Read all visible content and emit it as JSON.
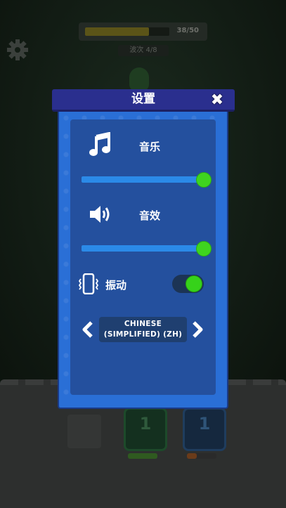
{
  "hud": {
    "progress_text": "38/50",
    "progress_value": 0.76,
    "wave_text": "波次 4/8"
  },
  "settings": {
    "title": "设置",
    "music": {
      "label": "音乐",
      "volume": 1.0
    },
    "sound": {
      "label": "音效",
      "volume": 1.0
    },
    "vibration": {
      "label": "振动",
      "enabled": true
    },
    "language": {
      "line1": "CHINESE",
      "line2": "(SIMPLIFIED) (ZH)"
    }
  },
  "cards": [
    {
      "number": "1"
    },
    {
      "number": "1"
    }
  ],
  "colors": {
    "panel_blue": "#2a6fd6",
    "header_navy": "#2a2f8e",
    "accent_green": "#3fd41f"
  },
  "icons": [
    "gear-icon",
    "music-icon",
    "speaker-icon",
    "vibration-icon",
    "close-icon",
    "chevron-left-icon",
    "chevron-right-icon"
  ]
}
